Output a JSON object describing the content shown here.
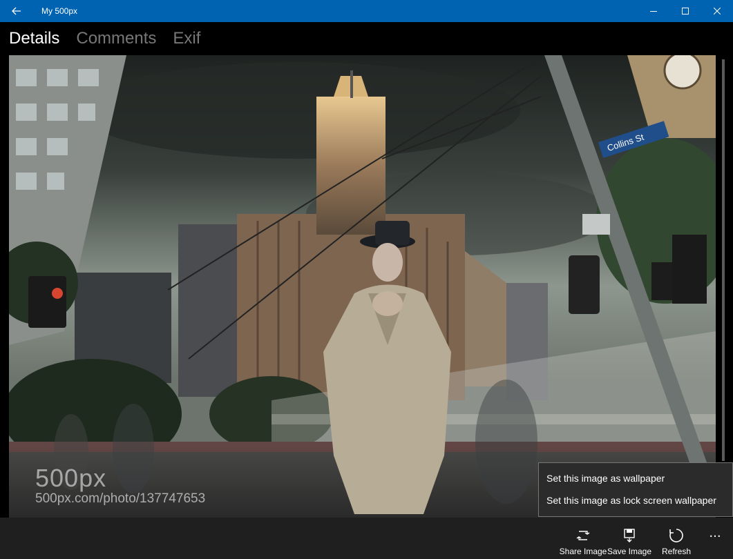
{
  "window": {
    "title": "My 500px"
  },
  "tabs": [
    {
      "label": "Details",
      "active": true
    },
    {
      "label": "Comments",
      "active": false
    },
    {
      "label": "Exif",
      "active": false
    }
  ],
  "photo": {
    "watermark_logo": "500px",
    "watermark_url": "500px.com/photo/137747653",
    "street_sign": "Collins St"
  },
  "flyout": {
    "items": [
      {
        "label": "Set this image as wallpaper"
      },
      {
        "label": "Set this image as lock screen wallpaper"
      }
    ]
  },
  "commands": [
    {
      "label": "Share Image",
      "icon": "share-icon"
    },
    {
      "label": "Save Image",
      "icon": "save-icon"
    },
    {
      "label": "Refresh",
      "icon": "refresh-icon"
    }
  ],
  "more_label": "...",
  "colors": {
    "titlebar": "#0063b1",
    "command_bar": "#1f1f1f",
    "flyout": "#2b2b2b"
  }
}
